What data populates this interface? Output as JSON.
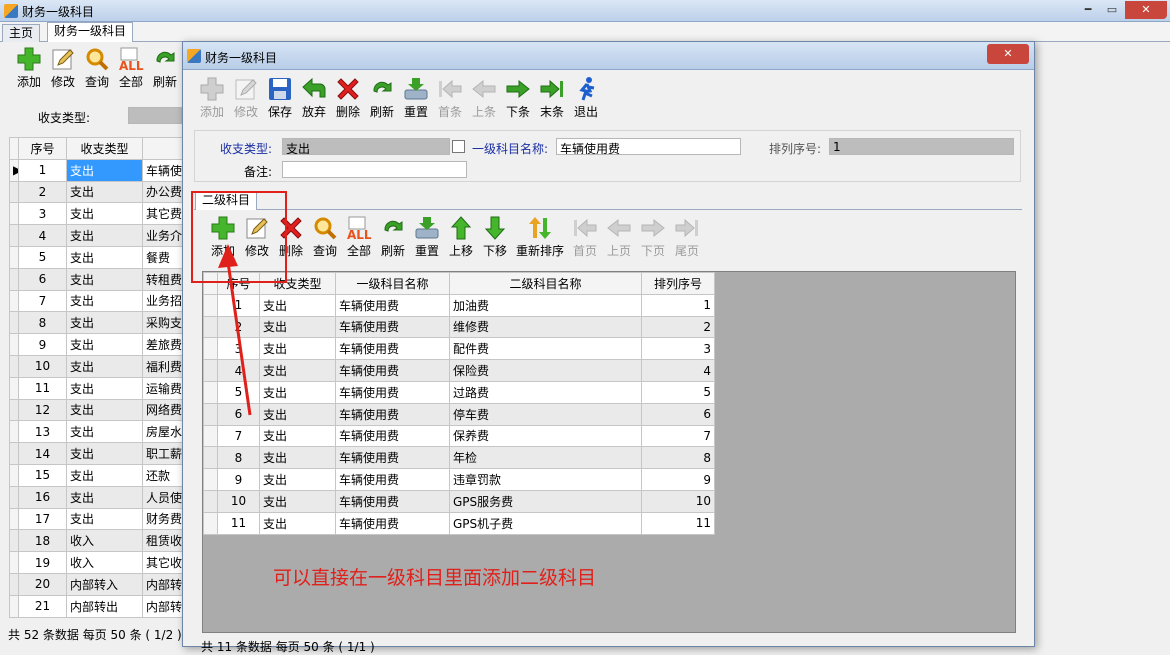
{
  "window": {
    "title": "财务一级科目"
  },
  "tabs": {
    "home": "主页",
    "current": "财务一级科目"
  },
  "main": {
    "toolbar": {
      "add": "添加",
      "edit": "修改",
      "query": "查询",
      "all": "全部",
      "refresh": "刷新"
    },
    "filter_label": "收支类型:",
    "columns": [
      "序号",
      "收支类型"
    ],
    "rows": [
      [
        "1",
        "支出",
        "车辆使"
      ],
      [
        "2",
        "支出",
        "办公费"
      ],
      [
        "3",
        "支出",
        "其它费"
      ],
      [
        "4",
        "支出",
        "业务介"
      ],
      [
        "5",
        "支出",
        "餐费"
      ],
      [
        "6",
        "支出",
        "转租费"
      ],
      [
        "7",
        "支出",
        "业务招"
      ],
      [
        "8",
        "支出",
        "采购支"
      ],
      [
        "9",
        "支出",
        "差旅费"
      ],
      [
        "10",
        "支出",
        "福利费"
      ],
      [
        "11",
        "支出",
        "运输费"
      ],
      [
        "12",
        "支出",
        "网络费"
      ],
      [
        "13",
        "支出",
        "房屋水"
      ],
      [
        "14",
        "支出",
        "职工薪"
      ],
      [
        "15",
        "支出",
        "还款"
      ],
      [
        "16",
        "支出",
        "人员使"
      ],
      [
        "17",
        "支出",
        "财务费"
      ],
      [
        "18",
        "收入",
        "租赁收"
      ],
      [
        "19",
        "收入",
        "其它收"
      ],
      [
        "20",
        "内部转入",
        "内部转"
      ],
      [
        "21",
        "内部转出",
        "内部转"
      ]
    ],
    "status": "共 52 条数据  每页 50 条 ( 1/2 )"
  },
  "dialog": {
    "title": "财务一级科目",
    "toolbar": {
      "add": "添加",
      "edit": "修改",
      "save": "保存",
      "discard": "放弃",
      "delete": "删除",
      "refresh": "刷新",
      "reset": "重置",
      "first": "首条",
      "prev": "上条",
      "next": "下条",
      "last": "末条",
      "exit": "退出"
    },
    "form": {
      "type_label": "收支类型:",
      "type_value": "支出",
      "name_label": "一级科目名称:",
      "name_value": "车辆使用费",
      "order_label": "排列序号:",
      "order_value": "1",
      "remark_label": "备注:"
    },
    "subtab": "二级科目",
    "subtoolbar": {
      "add": "添加",
      "edit": "修改",
      "delete": "删除",
      "query": "查询",
      "all": "全部",
      "refresh": "刷新",
      "reset": "重置",
      "up": "上移",
      "down": "下移",
      "reorder": "重新排序",
      "first": "首页",
      "prev": "上页",
      "next": "下页",
      "last": "尾页"
    },
    "columns": [
      "序号",
      "收支类型",
      "一级科目名称",
      "二级科目名称",
      "排列序号"
    ],
    "rows": [
      [
        "1",
        "支出",
        "车辆使用费",
        "加油费",
        "1"
      ],
      [
        "2",
        "支出",
        "车辆使用费",
        "维修费",
        "2"
      ],
      [
        "3",
        "支出",
        "车辆使用费",
        "配件费",
        "3"
      ],
      [
        "4",
        "支出",
        "车辆使用费",
        "保险费",
        "4"
      ],
      [
        "5",
        "支出",
        "车辆使用费",
        "过路费",
        "5"
      ],
      [
        "6",
        "支出",
        "车辆使用费",
        "停车费",
        "6"
      ],
      [
        "7",
        "支出",
        "车辆使用费",
        "保养费",
        "7"
      ],
      [
        "8",
        "支出",
        "车辆使用费",
        "年检",
        "8"
      ],
      [
        "9",
        "支出",
        "车辆使用费",
        "违章罚款",
        "9"
      ],
      [
        "10",
        "支出",
        "车辆使用费",
        "GPS服务费",
        "10"
      ],
      [
        "11",
        "支出",
        "车辆使用费",
        "GPS机子费",
        "11"
      ]
    ],
    "status": "共 11 条数据  每页 50 条 ( 1/1 )"
  },
  "annotation": {
    "text": "可以直接在一级科目里面添加二级科目",
    "color": "#e0201a"
  }
}
